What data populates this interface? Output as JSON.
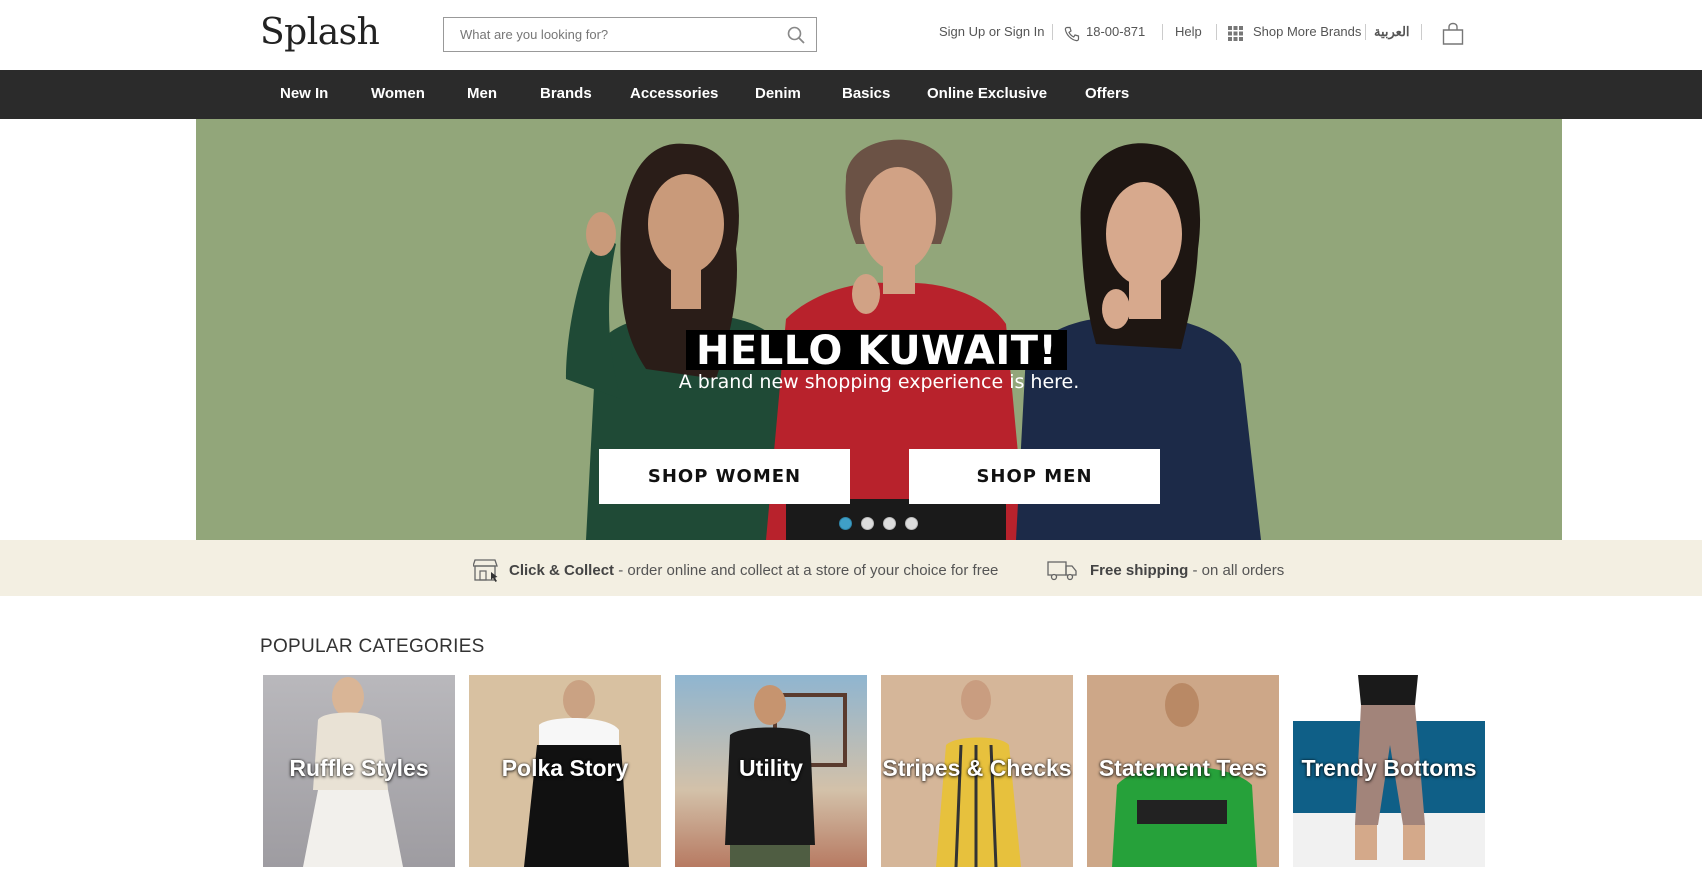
{
  "header": {
    "logo": "Splash",
    "search": {
      "placeholder": "What are you looking for?"
    },
    "sign_in": "Sign Up or Sign In",
    "phone": "18-00-871",
    "help": "Help",
    "more_brands": "Shop More Brands",
    "language": "العربية"
  },
  "nav": {
    "items": [
      "New In",
      "Women",
      "Men",
      "Brands",
      "Accessories",
      "Denim",
      "Basics",
      "Online Exclusive",
      "Offers"
    ]
  },
  "hero": {
    "background_color": "#92a67a",
    "title": "HELLO KUWAIT!",
    "subtitle": "A brand new shopping experience is here.",
    "shop_women": "SHOP WOMEN",
    "shop_men": "SHOP MEN",
    "slide_count": 4,
    "active_slide": 1
  },
  "infobar": {
    "collect_title": "Click & Collect",
    "collect_text": " - order online and collect at a store of your choice for free",
    "shipping_title": "Free shipping",
    "shipping_text": " - on all orders"
  },
  "categories": {
    "heading": "POPULAR CATEGORIES",
    "items": [
      {
        "label": "Ruffle Styles"
      },
      {
        "label": "Polka Story"
      },
      {
        "label": "Utility"
      },
      {
        "label": "Stripes & Checks"
      },
      {
        "label": "Statement Tees"
      },
      {
        "label": "Trendy Bottoms"
      }
    ]
  },
  "colors": {
    "nav_bg": "#2b2b2b",
    "infobar_bg": "#f3efe2",
    "dot_active": "#3f9fc7"
  }
}
